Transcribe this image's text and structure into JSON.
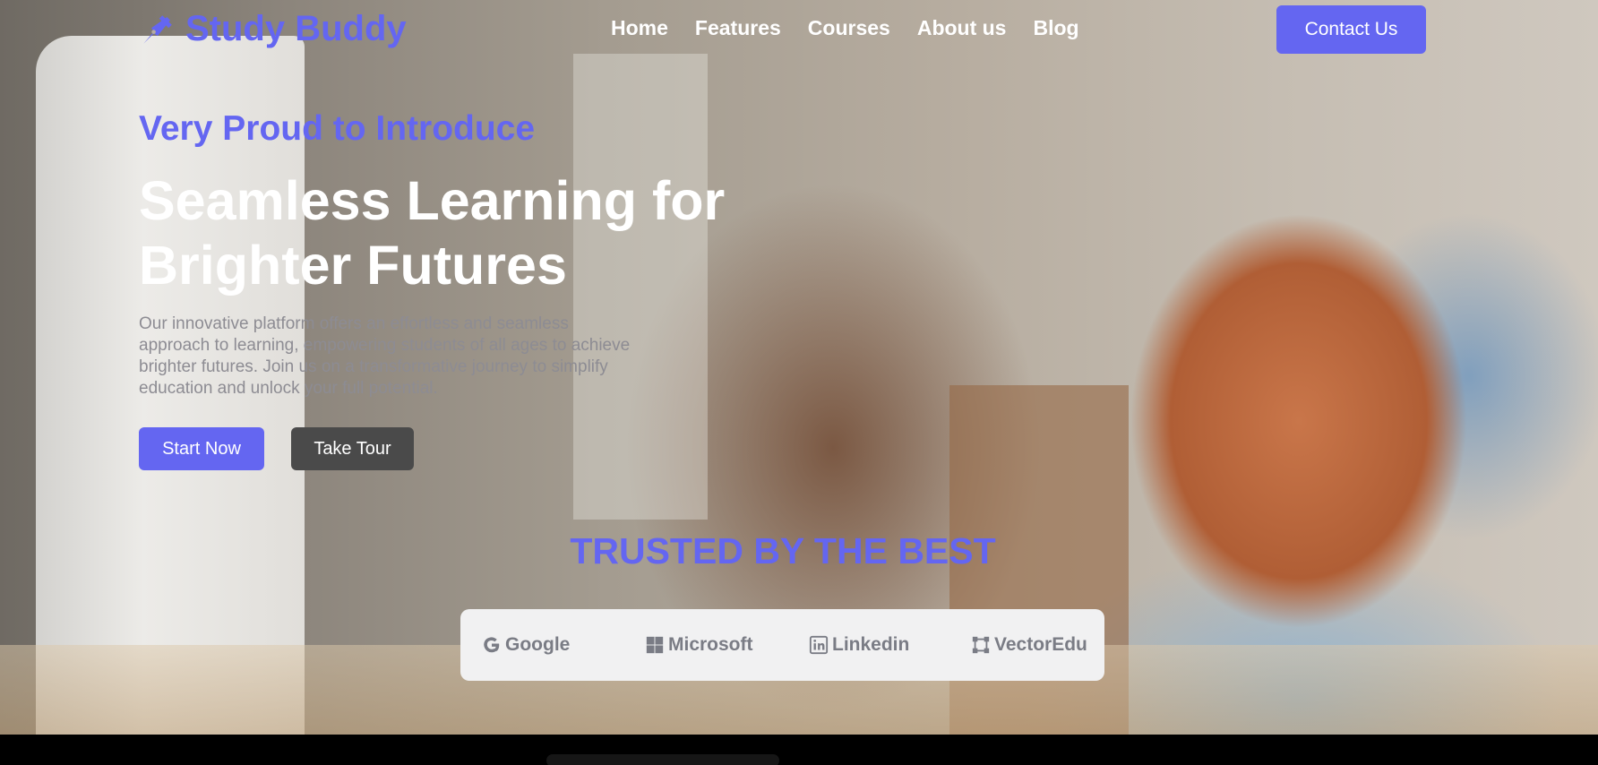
{
  "brand": {
    "name": "Study Buddy",
    "accent": "#6466f1"
  },
  "nav": {
    "items": [
      {
        "label": "Home"
      },
      {
        "label": "Features"
      },
      {
        "label": "Courses"
      },
      {
        "label": "About us"
      },
      {
        "label": "Blog"
      }
    ],
    "contact_label": "Contact Us"
  },
  "hero": {
    "eyebrow": "Very Proud to Introduce",
    "headline_line1": "Seamless Learning for",
    "headline_line2": "Brighter Futures",
    "description": "Our innovative platform offers an effortless and seamless approach to learning, empowering students of all ages to achieve brighter futures. Join us on a transformative journey to simplify education and unlock your full potential.",
    "start_label": "Start Now",
    "tour_label": "Take Tour"
  },
  "trusted": {
    "heading": "TRUSTED BY THE BEST",
    "partners": [
      {
        "name": "Google",
        "icon": "google-icon"
      },
      {
        "name": "Microsoft",
        "icon": "microsoft-icon"
      },
      {
        "name": "Linkedin",
        "icon": "linkedin-icon"
      },
      {
        "name": "VectorEdu",
        "icon": "vectoredu-icon"
      }
    ]
  },
  "colors": {
    "button_secondary": "#4a4a4a",
    "logo_bar_bg": "#f1f1f2",
    "partner_text": "#7a7c85"
  }
}
